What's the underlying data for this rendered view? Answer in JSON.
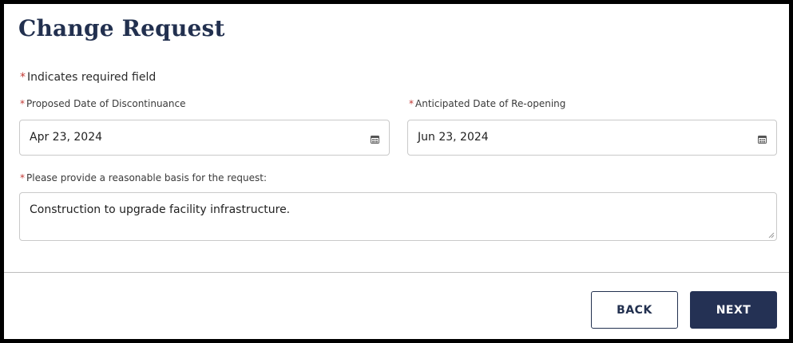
{
  "page": {
    "title": "Change Request"
  },
  "form": {
    "required_marker": "*",
    "required_note": "Indicates required field",
    "discontinuance": {
      "label": "Proposed Date of Discontinuance",
      "value": "Apr 23, 2024",
      "icon": "calendar-icon"
    },
    "reopening": {
      "label": "Anticipated Date of Re-opening",
      "value": "Jun 23, 2024",
      "icon": "calendar-icon"
    },
    "basis": {
      "label": "Please provide a reasonable basis for the request:",
      "value": "Construction to upgrade facility infrastructure."
    }
  },
  "footer": {
    "back_label": "BACK",
    "next_label": "NEXT"
  },
  "colors": {
    "primary": "#243154",
    "required": "#c23934",
    "border": "#c9c9c9"
  }
}
